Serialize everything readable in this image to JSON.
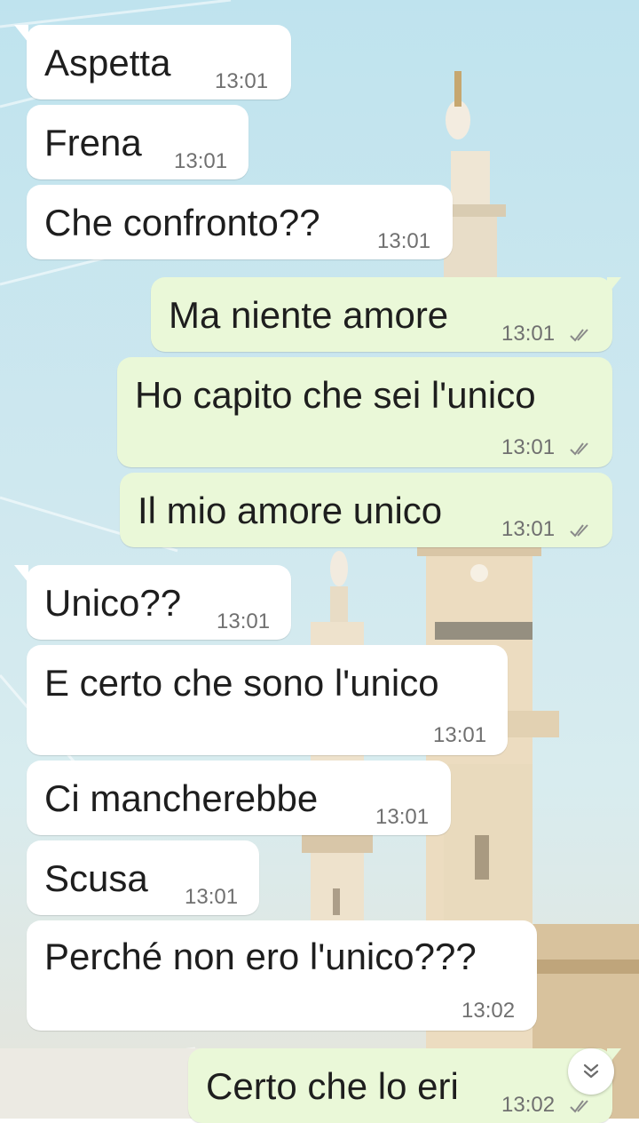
{
  "colors": {
    "incoming": "#ffffff",
    "outgoing": "#eaf8d8",
    "time": "#707070",
    "text": "#1e1e1e"
  },
  "messages": [
    {
      "dir": "in",
      "text": "Aspetta",
      "time": "13:01"
    },
    {
      "dir": "in",
      "text": "Frena",
      "time": "13:01"
    },
    {
      "dir": "in",
      "text": "Che confronto??",
      "time": "13:01"
    },
    {
      "dir": "out",
      "text": "Ma niente amore",
      "time": "13:01",
      "status_icon": "double-check-icon"
    },
    {
      "dir": "out",
      "text": "Ho capito che sei l'unico",
      "time": "13:01",
      "status_icon": "double-check-icon"
    },
    {
      "dir": "out",
      "text": "Il mio amore unico",
      "time": "13:01",
      "status_icon": "double-check-icon"
    },
    {
      "dir": "in",
      "text": "Unico??",
      "time": "13:01"
    },
    {
      "dir": "in",
      "text": "E certo che sono l'unico",
      "time": "13:01"
    },
    {
      "dir": "in",
      "text": "Ci mancherebbe",
      "time": "13:01"
    },
    {
      "dir": "in",
      "text": "Scusa",
      "time": "13:01"
    },
    {
      "dir": "in",
      "text": "Perché non ero l'unico???",
      "time": "13:02"
    },
    {
      "dir": "out",
      "text": "Certo che lo eri",
      "time": "13:02",
      "status_icon": "double-check-icon"
    }
  ],
  "scroll_button": {
    "icon": "double-chevron-down-icon"
  }
}
